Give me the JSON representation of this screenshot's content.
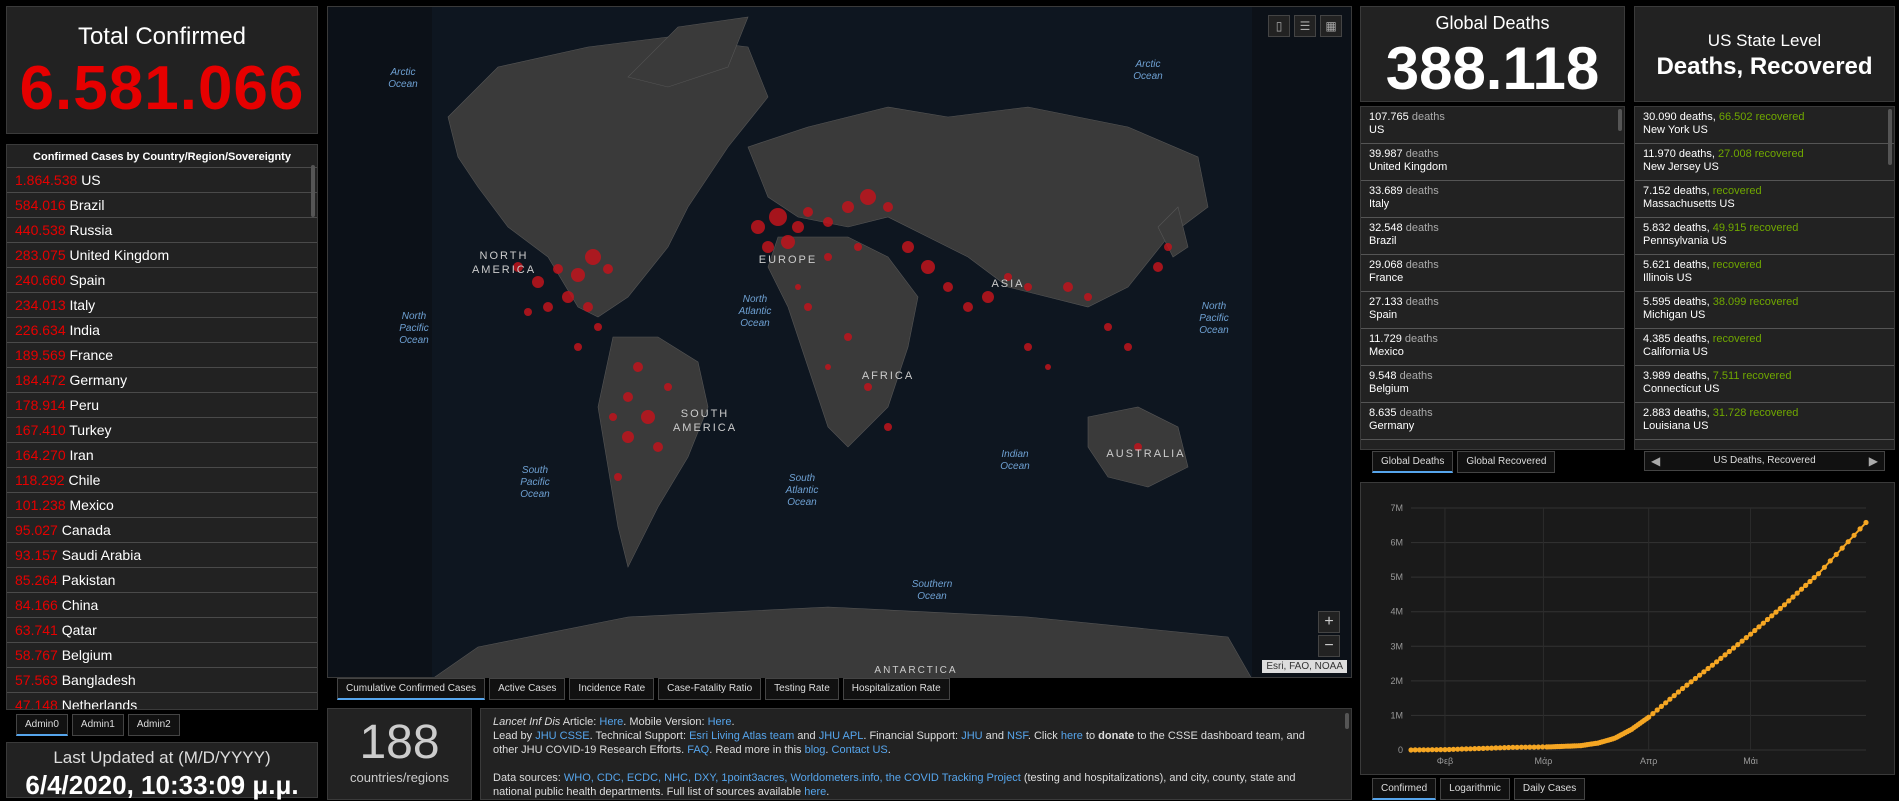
{
  "total": {
    "label": "Total Confirmed",
    "value": "6.581.066"
  },
  "countries": {
    "header": "Confirmed Cases by Country/Region/Sovereignty",
    "rows": [
      {
        "count": "1.864.538",
        "name": "US"
      },
      {
        "count": "584.016",
        "name": "Brazil"
      },
      {
        "count": "440.538",
        "name": "Russia"
      },
      {
        "count": "283.075",
        "name": "United Kingdom"
      },
      {
        "count": "240.660",
        "name": "Spain"
      },
      {
        "count": "234.013",
        "name": "Italy"
      },
      {
        "count": "226.634",
        "name": "India"
      },
      {
        "count": "189.569",
        "name": "France"
      },
      {
        "count": "184.472",
        "name": "Germany"
      },
      {
        "count": "178.914",
        "name": "Peru"
      },
      {
        "count": "167.410",
        "name": "Turkey"
      },
      {
        "count": "164.270",
        "name": "Iran"
      },
      {
        "count": "118.292",
        "name": "Chile"
      },
      {
        "count": "101.238",
        "name": "Mexico"
      },
      {
        "count": "95.027",
        "name": "Canada"
      },
      {
        "count": "93.157",
        "name": "Saudi Arabia"
      },
      {
        "count": "85.264",
        "name": "Pakistan"
      },
      {
        "count": "84.166",
        "name": "China"
      },
      {
        "count": "63.741",
        "name": "Qatar"
      },
      {
        "count": "58.767",
        "name": "Belgium"
      },
      {
        "count": "57.563",
        "name": "Bangladesh"
      },
      {
        "count": "47.148",
        "name": "Netherlands"
      }
    ],
    "tabs": [
      "Admin0",
      "Admin1",
      "Admin2"
    ]
  },
  "updated": {
    "label": "Last Updated at (M/D/YYYY)",
    "value": "6/4/2020, 10:33:09 μ.μ."
  },
  "map": {
    "labels": {
      "arctic_left": [
        "Arctic",
        "Ocean"
      ],
      "arctic_right": [
        "Arctic",
        "Ocean"
      ],
      "north_america": [
        "NORTH",
        "AMERICA"
      ],
      "europe": "EUROPE",
      "asia": "ASIA",
      "africa": "AFRICA",
      "south_america": [
        "SOUTH",
        "AMERICA"
      ],
      "australia": "AUSTRALIA",
      "antarctica": "ANTARCTICA",
      "north_pacific_left": [
        "North",
        "Pacific",
        "Ocean"
      ],
      "north_pacific_right": [
        "North",
        "Pacific",
        "Ocean"
      ],
      "north_atlantic": [
        "North",
        "Atlantic",
        "Ocean"
      ],
      "south_pacific": [
        "South",
        "Pacific",
        "Ocean"
      ],
      "south_atlantic": [
        "South",
        "Atlantic",
        "Ocean"
      ],
      "indian": [
        "Indian",
        "Ocean"
      ],
      "southern": [
        "Southern",
        "Ocean"
      ]
    },
    "attribution": "Esri, FAO, NOAA",
    "zoom_in": "+",
    "zoom_out": "−",
    "tabs": [
      "Cumulative Confirmed Cases",
      "Active Cases",
      "Incidence Rate",
      "Case-Fatality Ratio",
      "Testing Rate",
      "Hospitalization Rate"
    ]
  },
  "country_count": {
    "value": "188",
    "label": "countries/regions"
  },
  "info": {
    "line1a": "Lancet Inf Dis",
    "line1b": " Article: ",
    "line1c": "Here",
    "line1d": ". Mobile Version: ",
    "line1e": "Here",
    "line1f": ".",
    "line2a": "Lead by ",
    "line2b": "JHU CSSE",
    "line2c": ". Technical Support: ",
    "line2d": "Esri Living Atlas team",
    "line2e": " and ",
    "line2f": "JHU APL",
    "line2g": ". Financial Support: ",
    "line2h": "JHU",
    "line2i": " and ",
    "line2j": "NSF",
    "line2k": ". Click ",
    "line2l": "here",
    "line2m": " to ",
    "line2n": "donate",
    "line2o": " to the CSSE dashboard team, and",
    "line3a": "other JHU COVID-19 Research Efforts. ",
    "line3b": "FAQ",
    "line3c": ". Read more in this ",
    "line3d": "blog",
    "line3e": ". ",
    "line3f": "Contact US",
    "line3g": ".",
    "line4a": "Data sources: ",
    "line4b": "WHO, CDC, ECDC, NHC, DXY, 1point3acres, Worldometers.info, the COVID Tracking Project",
    "line4c": " (testing and hospitalizations), and city, county, state and",
    "line5a": "national public health departments. Full list of sources available ",
    "line5b": "here",
    "line5c": "."
  },
  "deaths": {
    "label": "Global Deaths",
    "value": "388.118",
    "unit": "deaths",
    "rows": [
      {
        "n": "107.765",
        "c": "US"
      },
      {
        "n": "39.987",
        "c": "United Kingdom"
      },
      {
        "n": "33.689",
        "c": "Italy"
      },
      {
        "n": "32.548",
        "c": "Brazil"
      },
      {
        "n": "29.068",
        "c": "France"
      },
      {
        "n": "27.133",
        "c": "Spain"
      },
      {
        "n": "11.729",
        "c": "Mexico"
      },
      {
        "n": "9.548",
        "c": "Belgium"
      },
      {
        "n": "8.635",
        "c": "Germany"
      }
    ],
    "tabs": [
      "Global Deaths",
      "Global Recovered"
    ]
  },
  "us": {
    "label1": "US State Level",
    "label2": "Deaths, Recovered",
    "deaths_unit": "deaths,",
    "recovered_unit": "recovered",
    "rows": [
      {
        "d": "30.090",
        "r": "66.502",
        "s": "New York US"
      },
      {
        "d": "11.970",
        "r": "27.008",
        "s": "New Jersey US"
      },
      {
        "d": "7.152",
        "r": "",
        "s": "Massachusetts US"
      },
      {
        "d": "5.832",
        "r": "49.915",
        "s": "Pennsylvania US"
      },
      {
        "d": "5.621",
        "r": "",
        "s": "Illinois US"
      },
      {
        "d": "5.595",
        "r": "38.099",
        "s": "Michigan US"
      },
      {
        "d": "4.385",
        "r": "",
        "s": "California US"
      },
      {
        "d": "3.989",
        "r": "7.511",
        "s": "Connecticut US"
      },
      {
        "d": "2.883",
        "r": "31.728",
        "s": "Louisiana US"
      }
    ],
    "nav_label": "US Deaths, Recovered",
    "nav_prev": "◀",
    "nav_next": "▶"
  },
  "chart_data": {
    "type": "line",
    "title": "",
    "xlabel": "",
    "ylabel": "",
    "x_ticks": [
      "Φεβ",
      "Μάρ",
      "Απρ",
      "Μάι"
    ],
    "y_ticks": [
      "0",
      "1M",
      "2M",
      "3M",
      "4M",
      "5M",
      "6M",
      "7M"
    ],
    "ylim": [
      0,
      7000000
    ],
    "x": [
      "Jan 22",
      "Feb 1",
      "Feb 11",
      "Feb 21",
      "Mar 2",
      "Mar 7",
      "Mar 12",
      "Mar 17",
      "Mar 22",
      "Mar 27",
      "Apr 1",
      "Apr 11",
      "Apr 21",
      "May 1",
      "May 11",
      "May 21",
      "Jun 4"
    ],
    "series": [
      {
        "values": [
          600,
          12000,
          43000,
          77000,
          90000,
          106000,
          128000,
          200000,
          340000,
          600000,
          950000,
          1780000,
          2550000,
          3350000,
          4200000,
          5100000,
          6581066
        ]
      }
    ],
    "color": "#f5a623",
    "tabs": [
      "Confirmed",
      "Logarithmic",
      "Daily Cases"
    ]
  }
}
